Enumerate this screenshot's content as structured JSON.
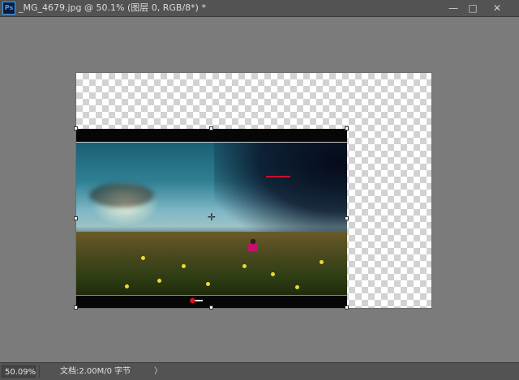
{
  "app": {
    "logo_text": "Ps"
  },
  "document": {
    "tab_title": "_MG_4679.jpg @ 50.1% (图层 0, RGB/8*) *"
  },
  "window_controls": {
    "minimize": "—",
    "maximize": "□",
    "close": "✕"
  },
  "status": {
    "zoom": "50.09%",
    "doc_info": "文档:2.00M/0 字节",
    "menu_arrow": "〉"
  },
  "icons": {
    "move_cursor": "✛"
  },
  "colors": {
    "workspace": "#7b7b7b",
    "chrome": "#535353",
    "ps_accent": "#3fa1ff"
  }
}
